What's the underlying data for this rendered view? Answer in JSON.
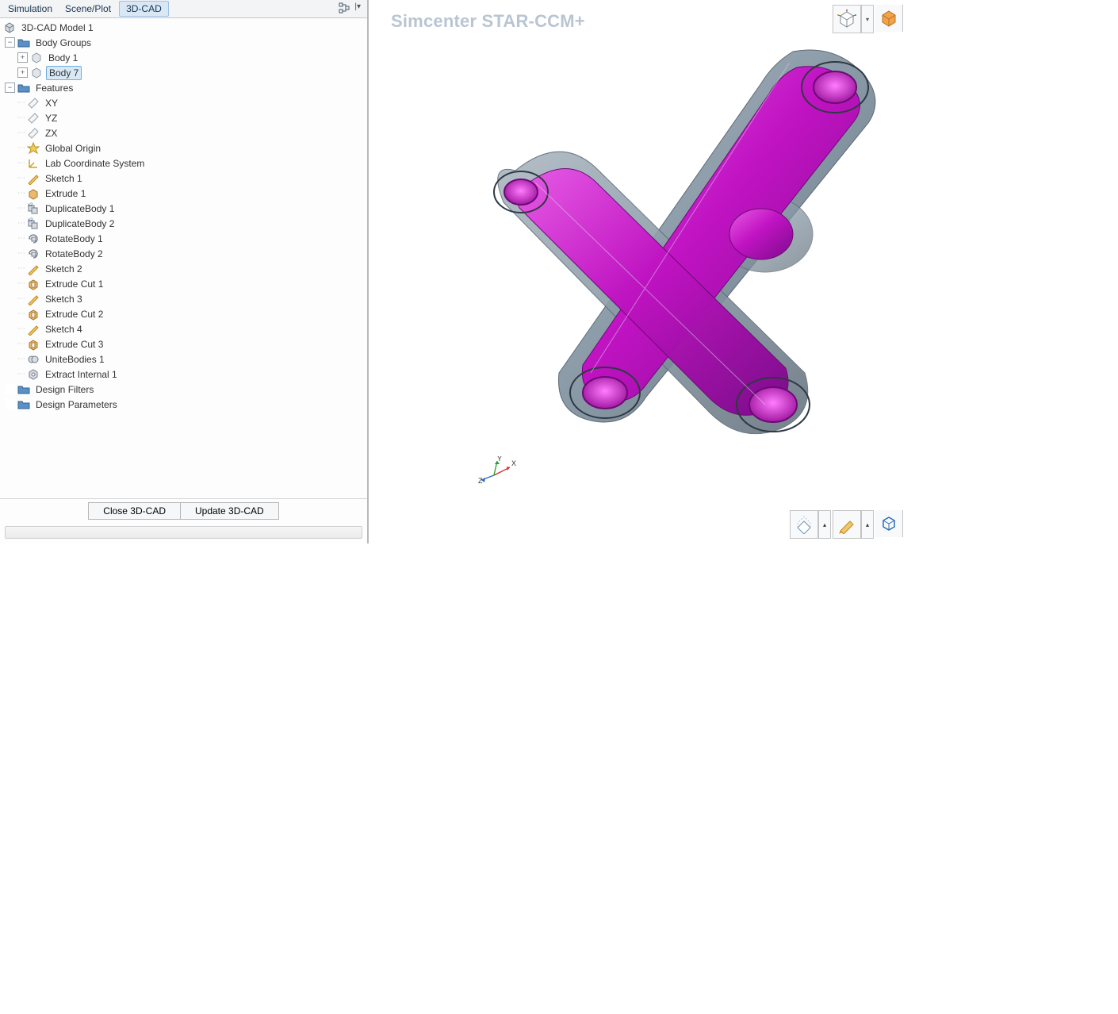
{
  "tabs": {
    "simulation": "Simulation",
    "sceneplot": "Scene/Plot",
    "cad": "3D-CAD"
  },
  "tree": {
    "root": "3D-CAD Model 1",
    "body_groups": "Body Groups",
    "body1": "Body 1",
    "body7": "Body 7",
    "features": "Features",
    "xy": "XY",
    "yz": "YZ",
    "zx": "ZX",
    "origin": "Global Origin",
    "labcs": "Lab Coordinate System",
    "sketch1": "Sketch 1",
    "extrude1": "Extrude 1",
    "dup1": "DuplicateBody 1",
    "dup2": "DuplicateBody 2",
    "rot1": "RotateBody 1",
    "rot2": "RotateBody 2",
    "sketch2": "Sketch 2",
    "ecut1": "Extrude Cut 1",
    "sketch3": "Sketch 3",
    "ecut2": "Extrude Cut 2",
    "sketch4": "Sketch 4",
    "ecut3": "Extrude Cut 3",
    "unite1": "UniteBodies 1",
    "extract1": "Extract Internal 1",
    "dfilters": "Design Filters",
    "dparams": "Design Parameters"
  },
  "buttons": {
    "close": "Close 3D-CAD",
    "update": "Update 3D-CAD"
  },
  "watermark": "Simcenter STAR-CCM+",
  "axes": {
    "x": "X",
    "y": "Y",
    "z": "Z"
  }
}
